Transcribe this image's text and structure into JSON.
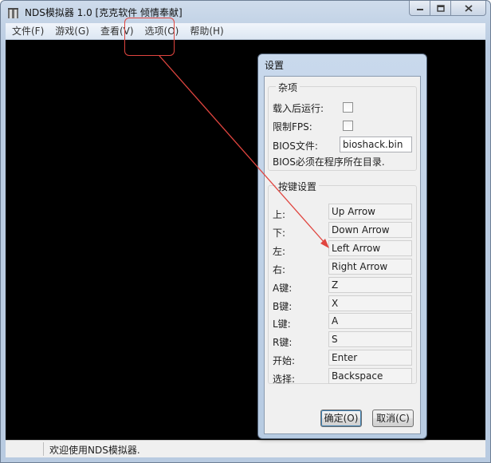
{
  "window": {
    "title": "NDS模拟器 1.0 [克克软件 倾情奉献]"
  },
  "menu": [
    {
      "label": "文件(F)"
    },
    {
      "label": "游戏(G)"
    },
    {
      "label": "查看(V)"
    },
    {
      "label": "选项(O)"
    },
    {
      "label": "帮助(H)"
    }
  ],
  "status": {
    "text": "欢迎使用NDS模拟器."
  },
  "dialog": {
    "title": "设置",
    "misc": {
      "label": "杂项",
      "run_after_load": "载入后运行:",
      "limit_fps": "限制FPS:",
      "bios_file_label": "BIOS文件:",
      "bios_file_value": "bioshack.bin",
      "bios_note": "BIOS必须在程序所在目录."
    },
    "keys": {
      "label": "按键设置",
      "rows": [
        {
          "name": "上:",
          "value": "Up Arrow"
        },
        {
          "name": "下:",
          "value": "Down Arrow"
        },
        {
          "name": "左:",
          "value": "Left Arrow"
        },
        {
          "name": "右:",
          "value": "Right Arrow"
        },
        {
          "name": "A键:",
          "value": "Z"
        },
        {
          "name": "B键:",
          "value": "X"
        },
        {
          "name": "L键:",
          "value": "A"
        },
        {
          "name": "R键:",
          "value": "S"
        },
        {
          "name": "开始:",
          "value": "Enter"
        },
        {
          "name": "选择:",
          "value": "Backspace"
        }
      ]
    },
    "ok_label": "确定(O)",
    "cancel_label": "取消(C)"
  },
  "colors": {
    "annotation": "#e0453f",
    "client_bg": "#000000",
    "frame": "#c3d3e6"
  }
}
